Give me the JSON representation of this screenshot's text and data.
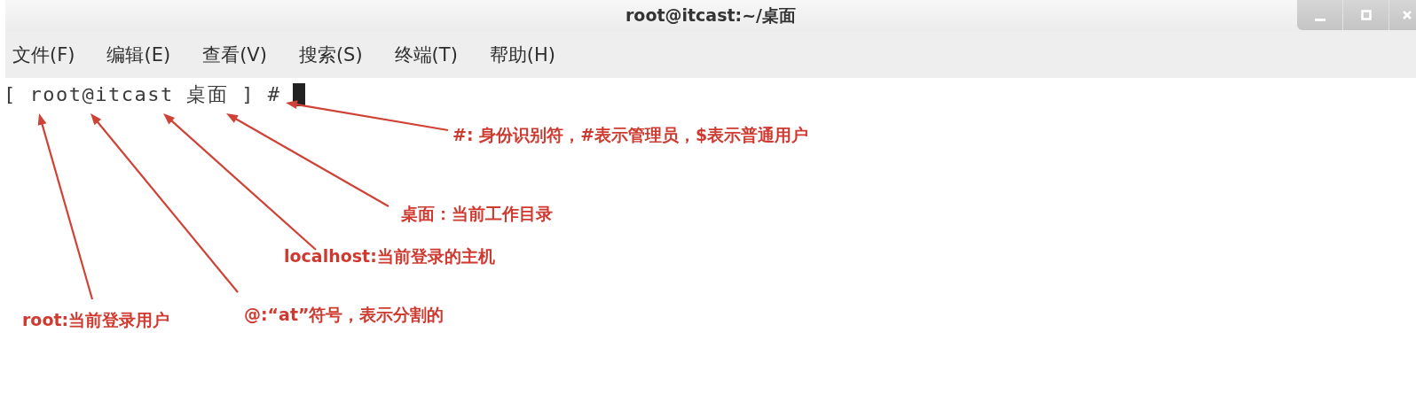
{
  "window": {
    "title": "root@itcast:~/桌面"
  },
  "menu": [
    {
      "label": "文件(F)"
    },
    {
      "label": "编辑(E)"
    },
    {
      "label": "查看(V)"
    },
    {
      "label": "搜索(S)"
    },
    {
      "label": "终端(T)"
    },
    {
      "label": "帮助(H)"
    }
  ],
  "terminal": {
    "prompt": "[ root@itcast 桌面 ] #"
  },
  "annotations": [
    {
      "text": "#: 身份识别符，#表示管理员，$表示普通用户"
    },
    {
      "text": "桌面：当前工作目录"
    },
    {
      "text": "localhost:当前登录的主机"
    },
    {
      "text": "root:当前登录用户"
    },
    {
      "text": "@:“at”符号，表示分割的"
    }
  ]
}
